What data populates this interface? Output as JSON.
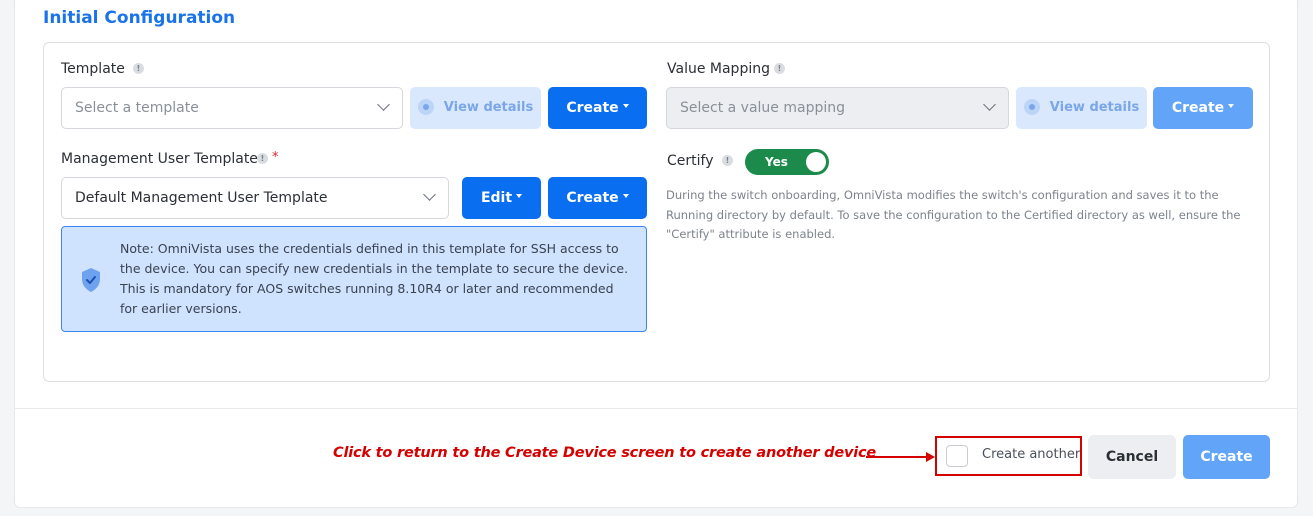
{
  "section": {
    "title": "Initial Configuration"
  },
  "template": {
    "label": "Template",
    "placeholder": "Select a template",
    "view_details": "View details",
    "create": "Create"
  },
  "value_mapping": {
    "label": "Value Mapping",
    "placeholder": "Select a value mapping",
    "view_details": "View details",
    "create": "Create"
  },
  "mgmt_user_template": {
    "label": "Management User Template",
    "required_mark": "*",
    "value": "Default Management User Template",
    "edit": "Edit",
    "create": "Create"
  },
  "note": {
    "text": "Note: OmniVista uses the credentials defined in this template for SSH access to the device. You can specify new credentials in the template to secure the device. This is mandatory for AOS switches running 8.10R4 or later and recommended for earlier versions."
  },
  "certify": {
    "label": "Certify",
    "toggle_value": "Yes",
    "help": "During the switch onboarding, OmniVista modifies the switch's configuration and saves it to the Running directory by default. To save the configuration to the Certified directory as well, ensure the \"Certify\" attribute is enabled."
  },
  "footer": {
    "annotation": "Click to return to the Create Device screen to create another device",
    "create_another": "Create another",
    "cancel": "Cancel",
    "create": "Create"
  },
  "colors": {
    "primary": "#0a6ef0",
    "primary_disabled": "#62a4f7",
    "title_blue": "#1a73e8",
    "toggle_on": "#1b8a4b",
    "annotation_red": "#d50000",
    "note_bg": "#cfe2fe"
  },
  "icons": {
    "info": "info-icon",
    "eye": "eye-icon",
    "shield": "shield-check-icon",
    "chevron": "chevron-down-icon",
    "caret": "caret-down-icon"
  }
}
